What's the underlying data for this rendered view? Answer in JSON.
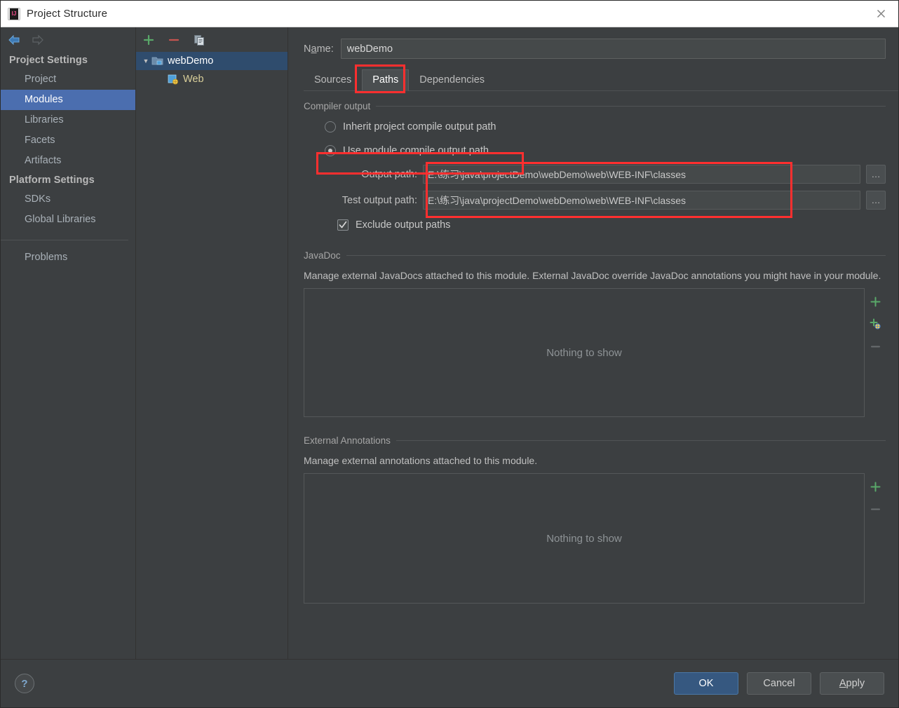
{
  "window": {
    "title": "Project Structure",
    "app_icon": "intellij-idea-icon",
    "close_label": "✕"
  },
  "sidebar": {
    "back_label": "◀",
    "forward_label": "▶",
    "groups": [
      {
        "header": "Project Settings",
        "items": [
          {
            "label": "Project",
            "selected": false
          },
          {
            "label": "Modules",
            "selected": true
          },
          {
            "label": "Libraries",
            "selected": false
          },
          {
            "label": "Facets",
            "selected": false
          },
          {
            "label": "Artifacts",
            "selected": false
          }
        ]
      },
      {
        "header": "Platform Settings",
        "items": [
          {
            "label": "SDKs",
            "selected": false
          },
          {
            "label": "Global Libraries",
            "selected": false
          }
        ]
      }
    ],
    "problems": "Problems"
  },
  "tree_panel": {
    "toolbar": {
      "add": "+",
      "remove": "−",
      "copy": "copy-icon"
    },
    "nodes": [
      {
        "label": "webDemo",
        "icon": "module-folder-icon",
        "arrow": "▼",
        "selected": true,
        "child": false
      },
      {
        "label": "Web",
        "icon": "web-facet-icon",
        "arrow": "",
        "selected": false,
        "child": true
      }
    ]
  },
  "main": {
    "name_label_pre": "N",
    "name_label_mnemonic": "a",
    "name_label_post": "me:",
    "name_value": "webDemo",
    "tabs": [
      {
        "label": "Sources",
        "active": false
      },
      {
        "label": "Paths",
        "active": true
      },
      {
        "label": "Dependencies",
        "active": false
      }
    ],
    "compiler_output": {
      "group_title": "Compiler output",
      "options": [
        {
          "label": "Inherit project compile output path",
          "checked": false
        },
        {
          "label": "Use module compile output path",
          "checked": true
        }
      ],
      "output_path_label": "Output path:",
      "output_path_value": "E:\\练习\\java\\projectDemo\\webDemo\\web\\WEB-INF\\classes",
      "test_output_path_label": "Test output path:",
      "test_output_path_value": "E:\\练习\\java\\projectDemo\\webDemo\\web\\WEB-INF\\classes",
      "browse_label": "…",
      "exclude_label": "Exclude output paths",
      "exclude_checked": true
    },
    "javadoc": {
      "group_title": "JavaDoc",
      "description": "Manage external JavaDocs attached to this module. External JavaDoc override JavaDoc annotations you might have in your module.",
      "empty_text": "Nothing to show",
      "actions": [
        "add-icon",
        "add-url-icon",
        "remove-icon"
      ]
    },
    "external_annotations": {
      "group_title": "External Annotations",
      "description": "Manage external annotations attached to this module.",
      "empty_text": "Nothing to show",
      "actions": [
        "add-icon",
        "remove-icon"
      ]
    }
  },
  "footer": {
    "help_label": "?",
    "ok_label": "OK",
    "cancel_label": "Cancel",
    "apply_label_mnemonic": "A",
    "apply_label_rest": "pply"
  },
  "colors": {
    "accent_selection": "#4b6eaf",
    "tree_selection": "#2f4c6d",
    "highlight_red": "#ff2f2f",
    "primary_button": "#365880",
    "panel_bg": "#3c3f41",
    "input_bg": "#45494a"
  }
}
